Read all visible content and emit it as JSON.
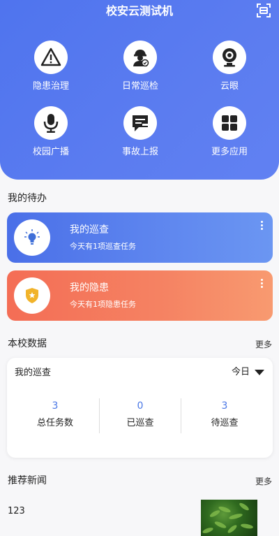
{
  "header": {
    "title": "校安云测试机"
  },
  "grid": [
    {
      "label": "隐患治理",
      "icon": "warning-icon"
    },
    {
      "label": "日常巡检",
      "icon": "inspector-icon"
    },
    {
      "label": "云眼",
      "icon": "camera-icon"
    },
    {
      "label": "校园广播",
      "icon": "microphone-icon"
    },
    {
      "label": "事故上报",
      "icon": "report-icon"
    },
    {
      "label": "更多应用",
      "icon": "apps-grid-icon"
    }
  ],
  "todo": {
    "title": "我的待办",
    "cards": [
      {
        "title": "我的巡查",
        "subtitle": "今天有1项巡查任务",
        "icon": "lightbulb-icon",
        "color": "#4f74ee"
      },
      {
        "title": "我的隐患",
        "subtitle": "今天有1项隐患任务",
        "icon": "shield-icon",
        "color": "#f46d55"
      }
    ]
  },
  "school_data": {
    "title": "本校数据",
    "more": "更多",
    "card_title": "我的巡查",
    "filter": "今日",
    "stats": [
      {
        "value": "3",
        "label": "总任务数"
      },
      {
        "value": "0",
        "label": "已巡查"
      },
      {
        "value": "3",
        "label": "待巡查"
      }
    ]
  },
  "news": {
    "title": "推荐新闻",
    "more": "更多",
    "items": [
      {
        "text": "123"
      }
    ]
  }
}
